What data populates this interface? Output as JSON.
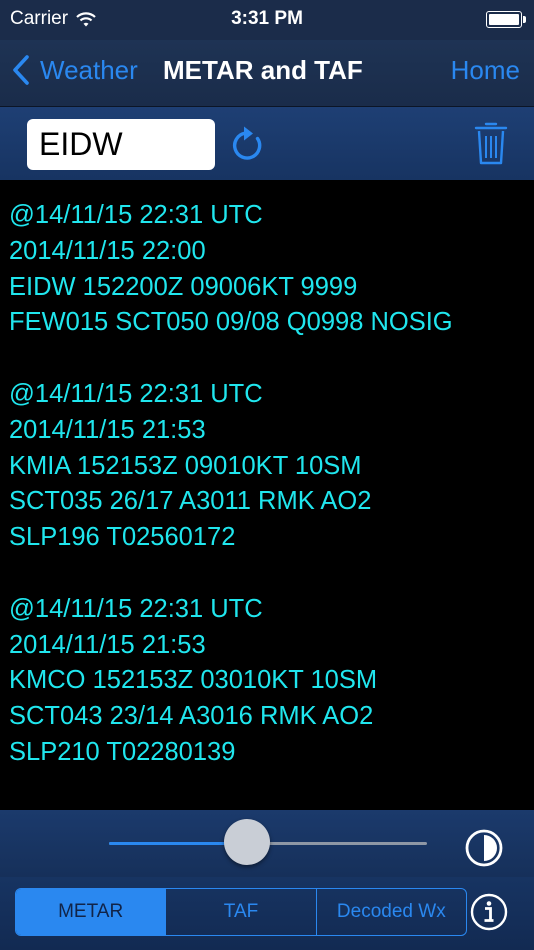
{
  "status_bar": {
    "carrier": "Carrier",
    "time": "3:31 PM"
  },
  "nav": {
    "back_label": "Weather",
    "title": "METAR and TAF",
    "home_label": "Home"
  },
  "toolbar": {
    "station_code": "EIDW"
  },
  "reports": [
    {
      "fetched": "@14/11/15 22:31 UTC",
      "observed": "2014/11/15 22:00",
      "line1": "EIDW 152200Z 09006KT 9999",
      "line2": "FEW015 SCT050 09/08 Q0998 NOSIG"
    },
    {
      "fetched": "@14/11/15 22:31 UTC",
      "observed": "2014/11/15 21:53",
      "line1": "KMIA 152153Z 09010KT 10SM",
      "line2": "SCT035 26/17 A3011 RMK AO2",
      "line3": "SLP196 T02560172"
    },
    {
      "fetched": "@14/11/15 22:31 UTC",
      "observed": "2014/11/15 21:53",
      "line1": "KMCO 152153Z 03010KT 10SM",
      "line2": "SCT043 23/14 A3016 RMK AO2",
      "line3": "SLP210 T02280139"
    }
  ],
  "font_slider": {
    "value_fraction": 0.435
  },
  "tabs": [
    {
      "label": "METAR",
      "active": true
    },
    {
      "label": "TAF",
      "active": false
    },
    {
      "label": "Decoded Wx",
      "active": false
    }
  ],
  "colors": {
    "accent": "#2a88f0",
    "report_text": "#20e6ee",
    "toolbar_bg": "#1e3f74"
  }
}
